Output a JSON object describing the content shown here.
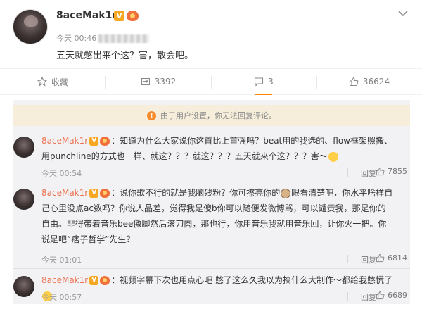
{
  "post": {
    "author": "8aceMak1r",
    "verified_icon": "v-verified-icon",
    "level_icon": "fan-level-icon",
    "time": "今天 00:46",
    "text": "五天就憋出来个这？害，散会吧。"
  },
  "actions": {
    "favorite": {
      "label": "收藏",
      "icon": "star-icon"
    },
    "repost": {
      "count": "3392",
      "icon": "repost-icon"
    },
    "comment": {
      "count": "3",
      "icon": "comment-icon"
    },
    "like": {
      "count": "36624",
      "icon": "thumb-up-icon"
    }
  },
  "notice": "由于用户设置，你无法回复评论。",
  "comments": [
    {
      "author": "8aceMak1r",
      "text": "：知道为什么大家说你这首比上首强吗？beat用的我选的、flow框架照搬、用punchline的方式也一样、就这？？？就这？？？五天就来个这？？？害～",
      "time": "今天 00:54",
      "reply": "回复",
      "likes": "7855"
    },
    {
      "author": "8aceMak1r",
      "text_1": "：说你歌不行的就是我脑残粉？你可擦亮你的",
      "text_2": "眼看清楚吧，你水平啥样自己心里没点ac数吗？你说人品差，觉得我是傻b你可以随便发微博骂，可以谴责我，那是你的自由。非得带着音乐bee儌脚然后滚刀肉，那也行，你用音乐我就用音乐回，让你火一把。你说是吧“痞子哲学”先生？",
      "time": "今天 01:01",
      "reply": "回复",
      "likes": "6814"
    },
    {
      "author": "8aceMak1r",
      "text": "：视频字幕下次也用点心吧 憋了这么久我以为搞什么大制作～都给我憋慌了",
      "time": "今天 00:57",
      "reply": "回复",
      "likes": "6689"
    }
  ],
  "colors": {
    "accent": "#ff8200",
    "name": "#eb7350",
    "notice_bg": "#f6eeda"
  }
}
